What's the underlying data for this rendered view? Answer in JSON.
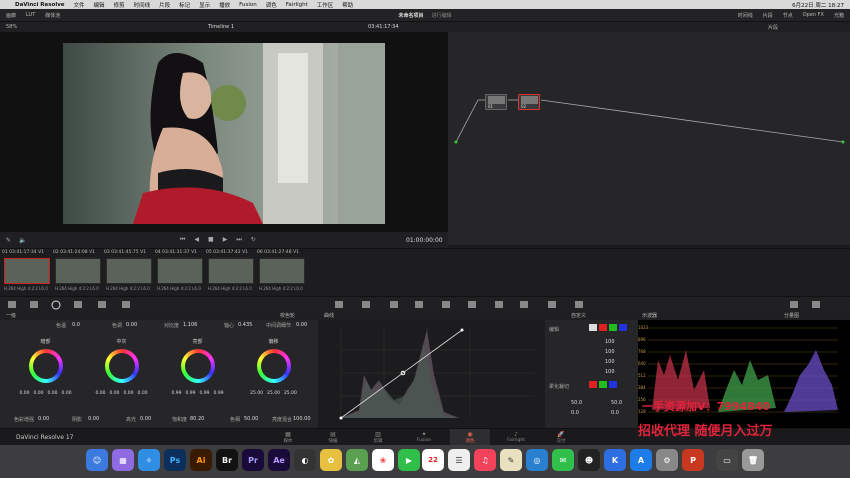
{
  "menubar": {
    "apple": "",
    "app": "DaVinci Resolve",
    "items": [
      "文件",
      "编辑",
      "修剪",
      "时间线",
      "片段",
      "标记",
      "显示",
      "播放",
      "Fusion",
      "调色",
      "Fairlight",
      "工作区",
      "帮助"
    ],
    "clock": "6月22日 周二 18:27"
  },
  "toolbar": {
    "left": [
      "画廊",
      "LUT",
      "媒体池"
    ],
    "project": "未命名项目",
    "status": "进行编辑",
    "right": [
      "时间线",
      "片段",
      "节点",
      "Open FX",
      "光箱"
    ],
    "zoom": "58%"
  },
  "viewer": {
    "timeline": "Timeline 1",
    "timecode": "03:41:17:34",
    "playhead": "01:00:00:00"
  },
  "nodes": {
    "title": "片段",
    "items": [
      {
        "label": "01"
      },
      {
        "label": "02"
      }
    ]
  },
  "clips": [
    {
      "index": "01",
      "tc": "03:41:17:34",
      "track": "V1",
      "codec": "H.264 High 4:2:2 L6.0",
      "selected": true
    },
    {
      "index": "02",
      "tc": "03:41:24:08",
      "track": "V1",
      "codec": "H.264 High 4:2:2 L6.0",
      "selected": false
    },
    {
      "index": "03",
      "tc": "03:41:45:75",
      "track": "V1",
      "codec": "H.264 High 4:2:2 L6.0",
      "selected": false
    },
    {
      "index": "04",
      "tc": "03:41:31:37",
      "track": "V1",
      "codec": "H.264 High 4:2:2 L6.0",
      "selected": false
    },
    {
      "index": "05",
      "tc": "03:41:37:42",
      "track": "V1",
      "codec": "H.264 High 4:2:2 L6.0",
      "selected": false
    },
    {
      "index": "06",
      "tc": "03:41:27:48",
      "track": "V1",
      "codec": "H.264 High 4:2:2 L6.0",
      "selected": false
    }
  ],
  "panel": {
    "title": "一级",
    "mode": "校色轮",
    "curves": "曲线",
    "custom": "自定义",
    "scope": "示波器",
    "scope_mode": "分量图"
  },
  "adjust": {
    "contrast_label": "色温",
    "contrast": "0.0",
    "tint_label": "色调",
    "tint": "0.00",
    "pivot_label": "对比度",
    "pivot": "1.106",
    "mid_label": "轴心",
    "mid": "0.435",
    "detail_label": "中间调细节",
    "detail": "0.00"
  },
  "wheels": [
    {
      "name": "暗部",
      "vals": [
        "0.00",
        "0.00",
        "0.00",
        "0.00"
      ]
    },
    {
      "name": "中灰",
      "vals": [
        "0.00",
        "0.00",
        "0.00",
        "0.00"
      ]
    },
    {
      "name": "亮部",
      "vals": [
        "0.99",
        "0.99",
        "0.99",
        "0.99"
      ]
    },
    {
      "name": "偏移",
      "vals": [
        "25.00",
        "25.00",
        "25.00"
      ]
    }
  ],
  "bottom_adjust": {
    "a_label": "色彩增强",
    "a": "0.00",
    "b_label": "阴影",
    "b": "0.00",
    "c_label": "高光",
    "c": "0.00",
    "d_label": "饱和度",
    "d": "80.20",
    "e_label": "色相",
    "e": "50.00",
    "f_label": "亮度混合",
    "f": "100.00"
  },
  "custom": {
    "edit": "编辑",
    "soft": "柔化裁切",
    "vals": [
      "100",
      "100",
      "100",
      "100"
    ],
    "low": "50.0",
    "high": "50.0",
    "ls": "0.0",
    "hs": "0.0"
  },
  "scope_ticks": [
    "1023",
    "896",
    "768",
    "640",
    "512",
    "384",
    "256",
    "128",
    "0"
  ],
  "pages": [
    "媒体",
    "快编",
    "剪辑",
    "Fusion",
    "调色",
    "Fairlight",
    "交付"
  ],
  "active_page": "调色",
  "brand": "DaVinci Resolve 17",
  "watermark": {
    "line1": "一手资源加V：7994840",
    "line2": "招收代理 随便月入过万"
  },
  "colors": {
    "accent": "#e65a2e",
    "scope_bg": "#000000",
    "watermark": "#e2233c"
  }
}
